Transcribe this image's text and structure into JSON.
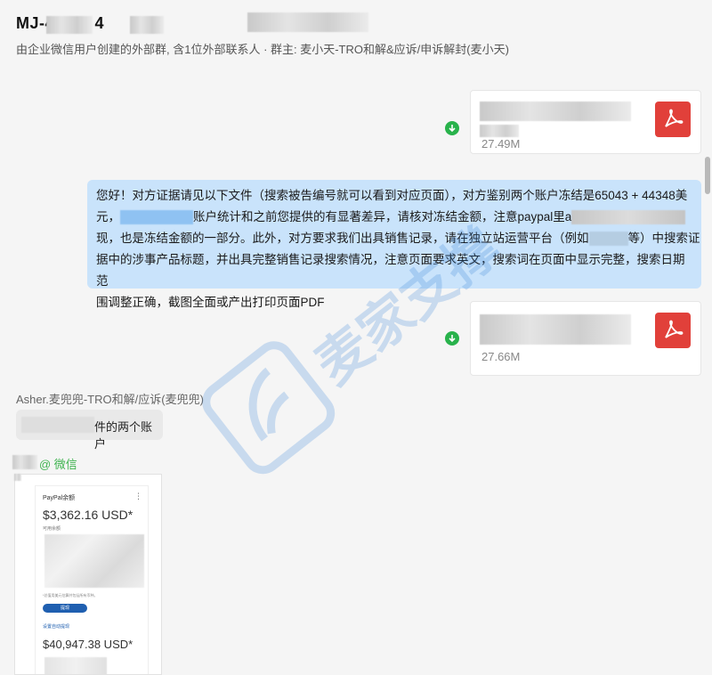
{
  "header": {
    "title": "MJ-4      NG-      4",
    "subtitle": "由企业微信用户创建的外部群, 含1位外部联系人 · 群主: 麦小天-TRO和解&应诉/申诉解封(麦小天)"
  },
  "files": [
    {
      "name": "",
      "size": "27.49M"
    },
    {
      "name": "",
      "size": "27.66M"
    }
  ],
  "message": {
    "line1": "您好！对方证据请见以下文件（搜索被告编号就可以看到对应页面），对方鉴别两个账户冻结是65043 + 44348美",
    "line2a": "元，",
    "line2b": "账户统计和之前您提供的有显著差异，请核对冻结金额，注意paypal里a",
    "line3": "现，也是冻结金额的一部分。此外，对方要求我们出具销售记录，请在独立站运营平台（例如",
    "line3b": "等）中搜索证",
    "line4": "据中的涉事产品标题，并出具完整销售记录搜索情况，注意页面要求英文，搜索词在页面中显示完整，搜索日期范",
    "line5": "围调整正确，截图全面或产出打印页面PDF"
  },
  "reply": {
    "sender": "Asher.麦兜兜-TRO和解/应诉(麦兜兜)",
    "text": "件的两个账户"
  },
  "wechat_tag": "@ 微信",
  "screenshot": {
    "heading": "PayPal余额",
    "amount1": "$3,362.16 USD*",
    "label1": "可用余额",
    "note": "*总值用美元估算并包括所有币种。",
    "button": "提现",
    "link": "设置自动提现",
    "amount2": "$40,947.38 USD*"
  },
  "watermark": {
    "text": "麦家支撑"
  },
  "colors": {
    "accent_blue": "#c9e3fb",
    "pdf_red": "#e1403a",
    "success_green": "#28b24b"
  }
}
